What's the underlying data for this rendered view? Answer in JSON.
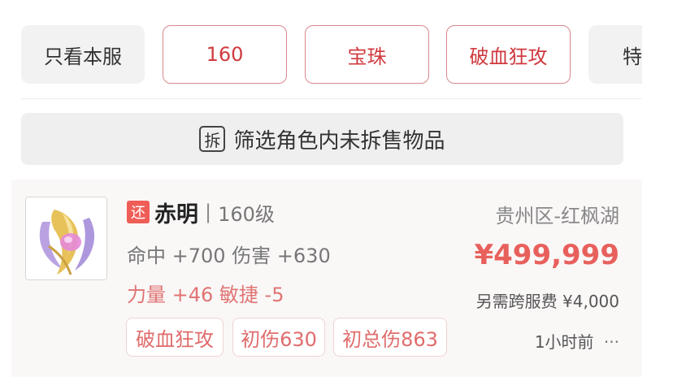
{
  "filters": {
    "only_this_server": "只看本服",
    "chips": [
      "160",
      "宝珠",
      "破血狂攻",
      "特"
    ]
  },
  "notice": {
    "icon_text": "拆",
    "text": "筛选角色内未拆售物品"
  },
  "listing": {
    "return_badge": "还",
    "name": "赤明",
    "separator": "|",
    "level": "160级",
    "stats_line1": "命中 +700 伤害 +630",
    "stats_line2": "力量 +46 敏捷 -5",
    "tags": [
      "破血狂攻",
      "初伤630",
      "初总伤863"
    ],
    "region": "贵州区-红枫湖",
    "price": "¥499,999",
    "extra_fee": "另需跨服费 ¥4,000",
    "time": "1小时前",
    "more": "···"
  },
  "colors": {
    "accent_red": "#d03a3f",
    "price_red": "#e8605c",
    "badge_red": "#ef5d57"
  }
}
